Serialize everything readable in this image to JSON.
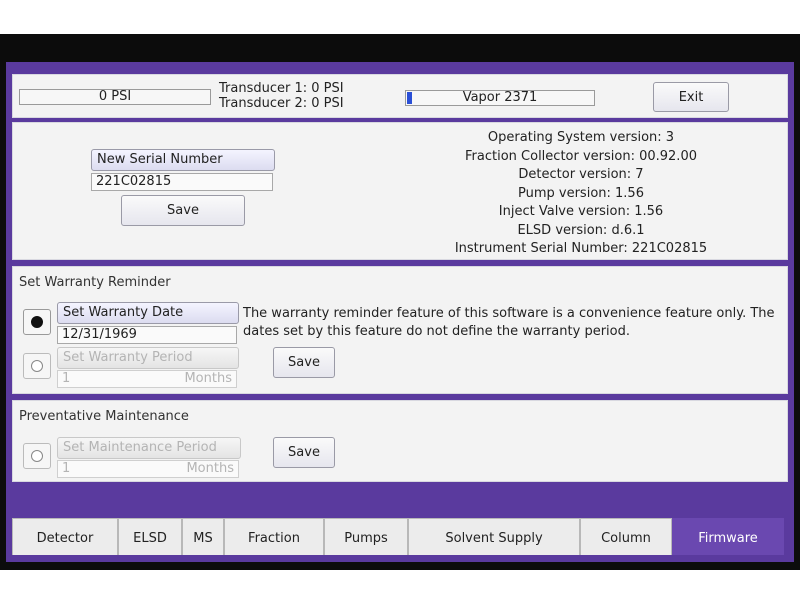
{
  "header": {
    "pressure": "0 PSI",
    "transducer1": "Transducer 1: 0 PSI",
    "transducer2": "Transducer 2: 0 PSI",
    "device_name": "Vapor 2371",
    "exit_label": "Exit"
  },
  "serial": {
    "label": "New Serial Number",
    "value": "221C02815",
    "save_label": "Save"
  },
  "versions": [
    "Operating System version: 3",
    "Fraction Collector version: 00.92.00",
    "Detector version: 7",
    "Pump version: 1.56",
    "Inject Valve version: 1.56",
    "ELSD version: d.6.1",
    "Instrument Serial Number: 221C02815"
  ],
  "warranty": {
    "title": "Set Warranty Reminder",
    "date_label": "Set Warranty Date",
    "date_value": "12/31/1969",
    "period_label": "Set Warranty Period",
    "period_value": "1",
    "period_unit": "Months",
    "notice_line1": "The warranty reminder feature of this software is a convenience feature only. The",
    "notice_line2": "dates set by this feature do not define the warranty period.",
    "save_label": "Save"
  },
  "maintenance": {
    "title": "Preventative Maintenance",
    "period_label": "Set Maintenance Period",
    "period_value": "1",
    "period_unit": "Months",
    "save_label": "Save"
  },
  "tabs": [
    {
      "label": "Detector"
    },
    {
      "label": "ELSD"
    },
    {
      "label": "MS"
    },
    {
      "label": "Fraction"
    },
    {
      "label": "Pumps"
    },
    {
      "label": "Solvent Supply"
    },
    {
      "label": "Column"
    },
    {
      "label": "Firmware"
    }
  ],
  "colors": {
    "frame": "#5a3a9e",
    "active_tab": "#6a48b0",
    "progress": "#2a4fd6"
  }
}
